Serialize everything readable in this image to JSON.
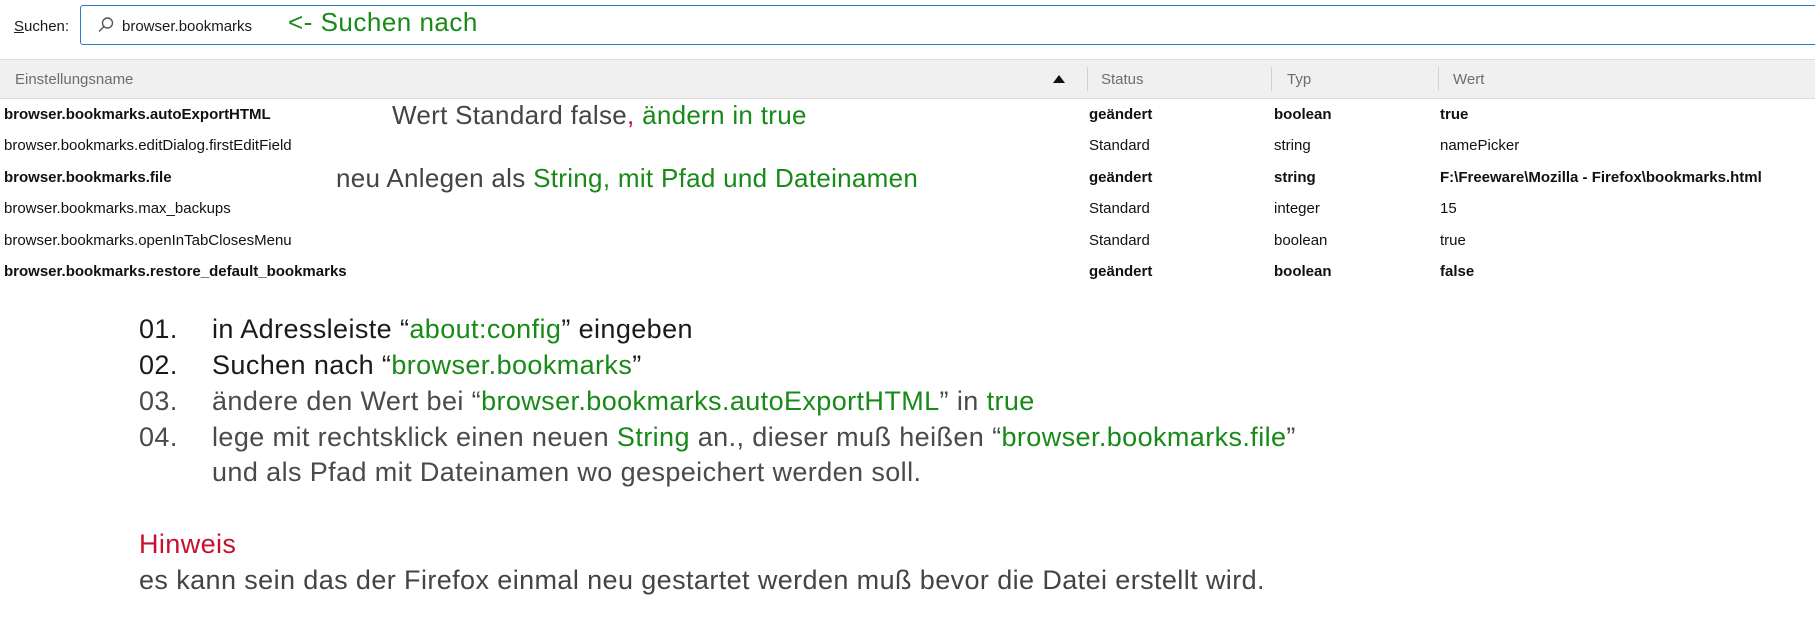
{
  "search": {
    "label_accel": "S",
    "label_rest": "uchen:",
    "value": "browser.bookmarks",
    "note": "<- Suchen nach"
  },
  "columns": {
    "name": "Einstellungsname",
    "status": "Status",
    "type": "Typ",
    "value": "Wert"
  },
  "rows": [
    {
      "name": "browser.bookmarks.autoExportHTML",
      "status": "geändert",
      "type": "boolean",
      "value": "true",
      "modified": true
    },
    {
      "name": "browser.bookmarks.editDialog.firstEditField",
      "status": "Standard",
      "type": "string",
      "value": "namePicker",
      "modified": false
    },
    {
      "name": "browser.bookmarks.file",
      "status": "geändert",
      "type": "string",
      "value": "F:\\Freeware\\Mozilla - Firefox\\bookmarks.html",
      "modified": true
    },
    {
      "name": "browser.bookmarks.max_backups",
      "status": "Standard",
      "type": "integer",
      "value": "15",
      "modified": false
    },
    {
      "name": "browser.bookmarks.openInTabClosesMenu",
      "status": "Standard",
      "type": "boolean",
      "value": "true",
      "modified": false
    },
    {
      "name": "browser.bookmarks.restore_default_bookmarks",
      "status": "geändert",
      "type": "boolean",
      "value": "false",
      "modified": true
    }
  ],
  "annotations": {
    "row1": {
      "a": "Wert Standard false",
      "b": ", ",
      "c": "ändern in true"
    },
    "row3": {
      "a": "neu Anlegen als ",
      "b": "String",
      "c": ", mit Pfad und Dateinamen"
    }
  },
  "steps": [
    {
      "num": "01.",
      "parts": [
        "in Adressleiste “",
        "about:config",
        "” eingeben"
      ]
    },
    {
      "num": "02.",
      "parts": [
        "Suchen nach “",
        "browser.bookmarks",
        "”"
      ]
    },
    {
      "num": "03.",
      "parts": [
        "ändere den Wert bei “",
        "browser.bookmarks.autoExportHTML",
        "” in ",
        "true"
      ]
    },
    {
      "num": "04.",
      "parts": [
        "lege mit rechtsklick einen neuen ",
        "String",
        " an., dieser muß heißen “",
        "browser.bookmarks.file",
        "”"
      ],
      "line2": "und als Pfad mit Dateinamen wo gespeichert werden soll."
    }
  ],
  "note": {
    "title": "Hinweis",
    "text": "es kann sein das der Firefox einmal neu gestartet werden muß bevor die Datei erstellt wird."
  },
  "colors": {
    "accent_green": "#178a17",
    "warning_red": "#c8102e",
    "focus_border": "#2b78c7"
  }
}
